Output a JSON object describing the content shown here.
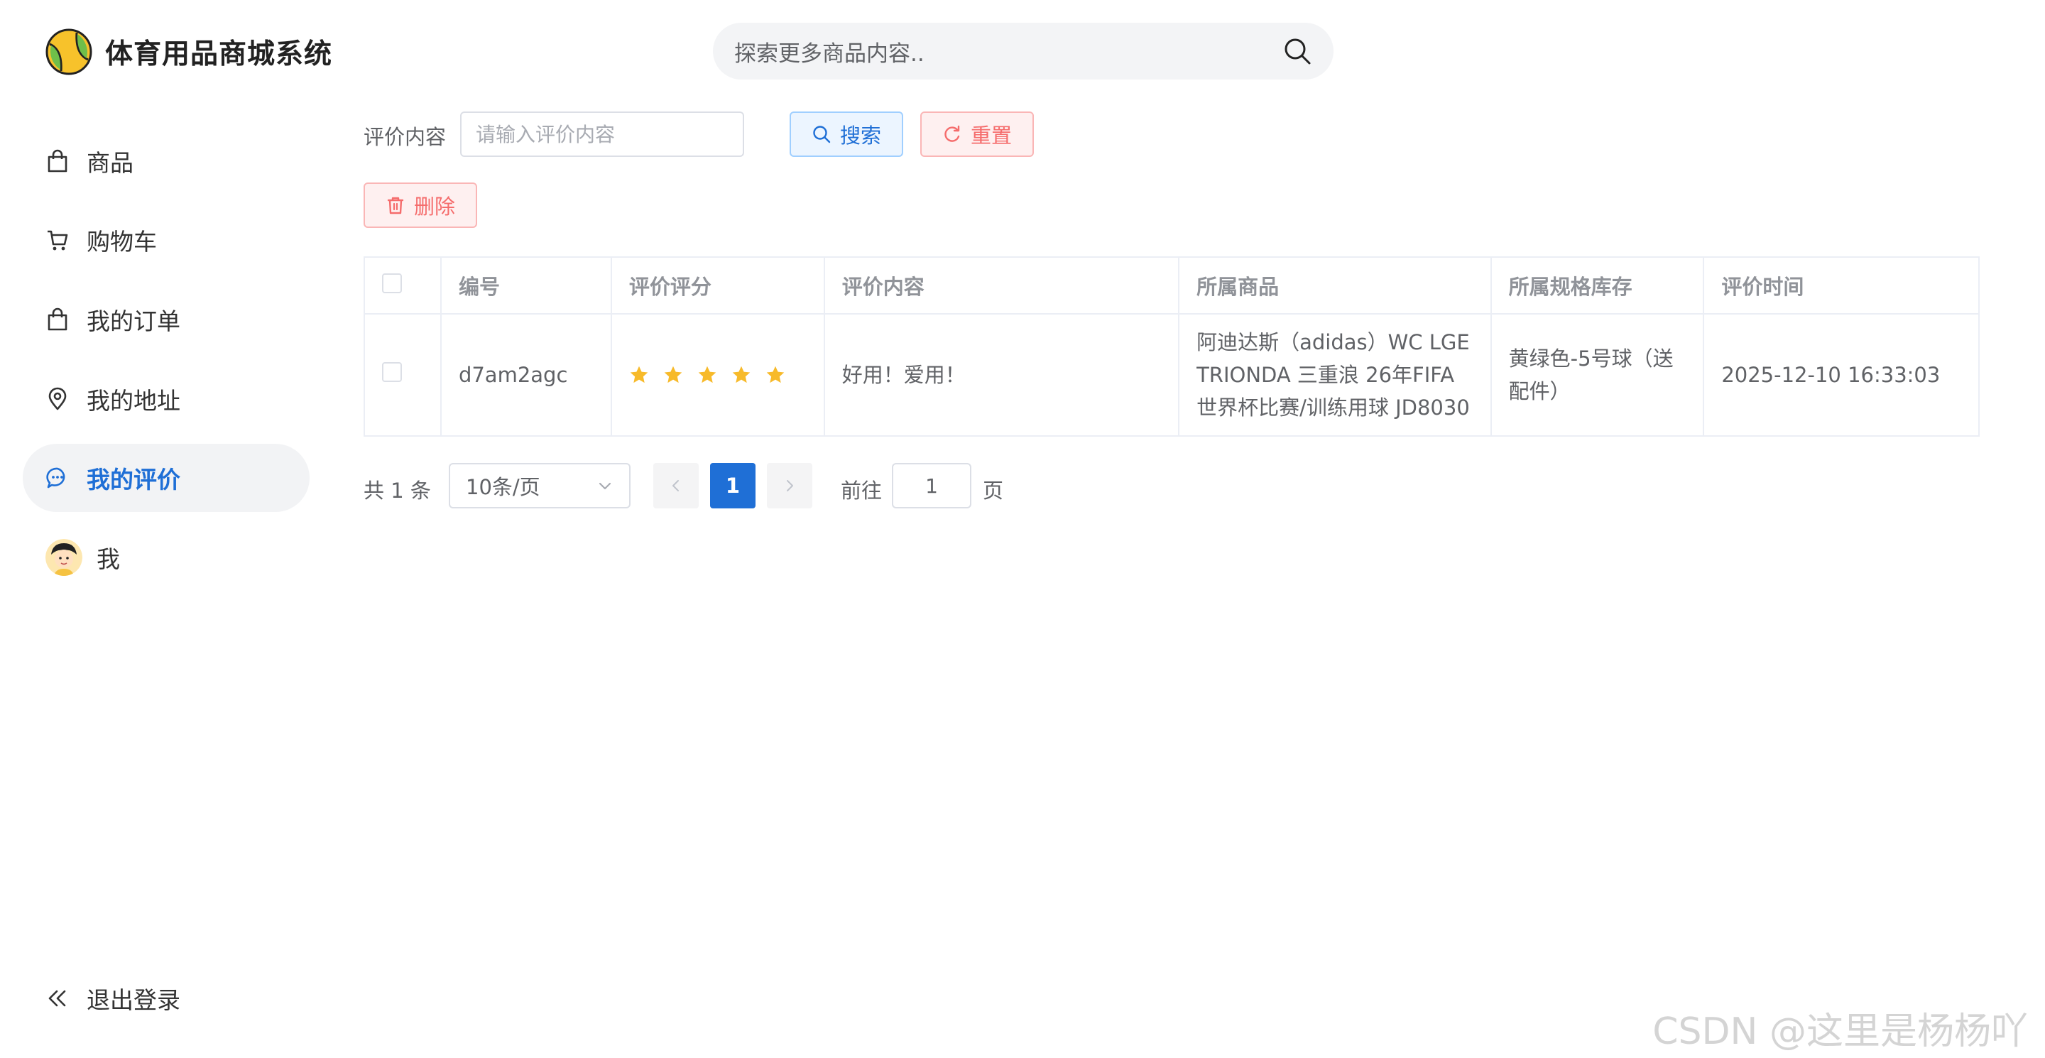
{
  "header": {
    "app_title": "体育用品商城系统",
    "search_placeholder": "探索更多商品内容.."
  },
  "sidebar": {
    "items": [
      {
        "label": "商品",
        "icon": "shopping-bag-icon"
      },
      {
        "label": "购物车",
        "icon": "cart-icon"
      },
      {
        "label": "我的订单",
        "icon": "order-bag-icon"
      },
      {
        "label": "我的地址",
        "icon": "location-pin-icon"
      },
      {
        "label": "我的评价",
        "icon": "chat-bubble-icon",
        "active": true
      },
      {
        "label": "我",
        "icon": "user-avatar"
      }
    ],
    "logout_label": "退出登录"
  },
  "filter": {
    "label": "评价内容",
    "input_placeholder": "请输入评价内容",
    "search_button": "搜索",
    "reset_button": "重置",
    "delete_button": "删除"
  },
  "table": {
    "headers": [
      "编号",
      "评价评分",
      "评价内容",
      "所属商品",
      "所属规格库存",
      "评价时间"
    ],
    "rows": [
      {
        "id": "d7am2agc",
        "rating": 5,
        "content": "好用！爱用！",
        "product": "阿迪达斯（adidas）WC LGE TRIONDA 三重浪 26年FIFA世界杯比赛/训练用球 JD8030",
        "spec": "黄绿色-5号球（送配件）",
        "time": "2025-12-10 16:33:03"
      }
    ]
  },
  "pagination": {
    "total_text": "共 1 条",
    "page_size": "10条/页",
    "current_page": "1",
    "goto_label": "前往",
    "goto_value": "1",
    "page_suffix": "页"
  },
  "watermark": "CSDN @这里是杨杨吖",
  "colors": {
    "primary": "#1f6fd6",
    "danger": "#f56c6c",
    "star": "#f7ba2a",
    "active_nav_bg": "#f2f3f5"
  }
}
